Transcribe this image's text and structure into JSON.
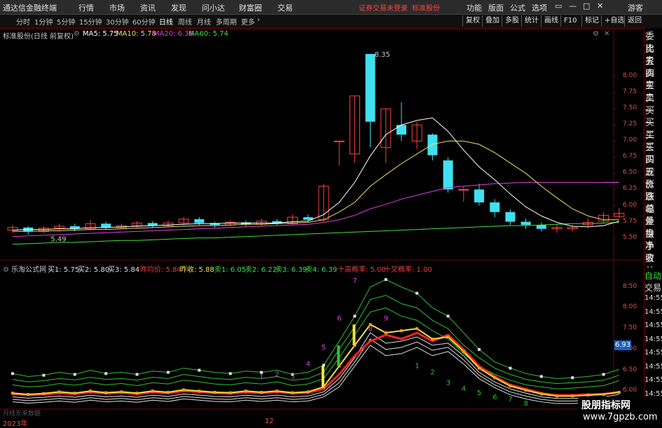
{
  "app": {
    "title": "通达信金融终端",
    "login_status": "证券交易未登录",
    "stock_name_top": "标准股份"
  },
  "top_menu": [
    "行情",
    "市场",
    "资讯",
    "发现",
    "问小达",
    "财富圈",
    "交易"
  ],
  "top_right_menu": [
    "功能",
    "版面",
    "公式",
    "选项"
  ],
  "user": "游客",
  "periods": [
    "分时",
    "1分钟",
    "5分钟",
    "15分钟",
    "30分钟",
    "60分钟",
    "日线",
    "周线",
    "月线",
    "多周期",
    "更多"
  ],
  "active_period": "日线",
  "toolbar": [
    "复权",
    "叠加",
    "多股",
    "统计",
    "画线",
    "F10",
    "标记",
    "+自选",
    "返回"
  ],
  "main_panel": {
    "title": "标准股份(日线 前复权)",
    "ma": [
      {
        "label": "MA5: 5.75",
        "color": "#ffffff"
      },
      {
        "label": "MA10: 5.78",
        "color": "#f0e060"
      },
      {
        "label": "MA20: 6.36",
        "color": "#e040e0"
      },
      {
        "label": "MA60: 5.74",
        "color": "#40e040"
      }
    ],
    "high_label": "8.35",
    "low_label": "5.49",
    "y_ticks": [
      "8.00",
      "7.75",
      "7.50",
      "7.25",
      "7.00",
      "6.75",
      "6.50",
      "6.25",
      "6.00",
      "5.75",
      "5.50"
    ]
  },
  "sub_panel": {
    "title": "乐淘公式网",
    "labels": [
      {
        "text": "买1: 5.75",
        "color": "#e0e0e0"
      },
      {
        "text": "买2: 5.80",
        "color": "#e0e0e0"
      },
      {
        "text": "买3: 5.84",
        "color": "#e0e0e0"
      },
      {
        "text": "昨均价: 5.84",
        "color": "#e04040"
      },
      {
        "text": "昨收: 5.88",
        "color": "#f0e060"
      },
      {
        "text": "卖1: 6.05",
        "color": "#40e040"
      },
      {
        "text": "卖2: 6.22",
        "color": "#40e040"
      },
      {
        "text": "卖3: 6.39",
        "color": "#40e040"
      },
      {
        "text": "卖4: 6.39",
        "color": "#40e040"
      },
      {
        "text": "十高概率: 5.00",
        "color": "#e04040"
      },
      {
        "text": "十叉概率: 1.00",
        "color": "#e04040"
      }
    ],
    "y_ticks": [
      "8.50",
      "8.00",
      "7.50",
      "7.00",
      "6.50",
      "6.00"
    ],
    "current_price": "6.93",
    "wave_numbers": [
      "1",
      "2",
      "3",
      "4",
      "5",
      "6",
      "7",
      "8",
      "9",
      "1",
      "2",
      "3",
      "4",
      "5",
      "6",
      "7",
      "8"
    ]
  },
  "side_labels": [
    "委比",
    "卖五",
    "卖四",
    "卖三",
    "卖二",
    "卖一",
    "买一",
    "买二",
    "买三",
    "买四",
    "买五",
    "现价",
    "涨跌",
    "涨幅",
    "总量",
    "外盘",
    "换手",
    "净资",
    "收益"
  ],
  "trade_panel": {
    "auto": "自动",
    "trade": "交易",
    "times": [
      "14:55",
      "14:55",
      "14:55",
      "14:55",
      "14:55",
      "14:55",
      "14:55",
      "14:55",
      "14:55"
    ]
  },
  "x_axis": [
    "2023年",
    "12"
  ],
  "watermark": {
    "line1": "股朋指标网",
    "line2": "www.7gpzb.com",
    "small": "月线东来数据"
  },
  "chart_data": {
    "type": "candlestick",
    "ylim": [
      5.3,
      8.6
    ],
    "candles": [
      {
        "o": 5.62,
        "c": 5.66,
        "h": 5.7,
        "l": 5.58
      },
      {
        "o": 5.66,
        "c": 5.6,
        "h": 5.68,
        "l": 5.55
      },
      {
        "o": 5.6,
        "c": 5.65,
        "h": 5.68,
        "l": 5.57
      },
      {
        "o": 5.65,
        "c": 5.68,
        "h": 5.72,
        "l": 5.62
      },
      {
        "o": 5.68,
        "c": 5.64,
        "h": 5.72,
        "l": 5.6
      },
      {
        "o": 5.64,
        "c": 5.72,
        "h": 5.78,
        "l": 5.62
      },
      {
        "o": 5.72,
        "c": 5.66,
        "h": 5.75,
        "l": 5.63
      },
      {
        "o": 5.66,
        "c": 5.69,
        "h": 5.72,
        "l": 5.64
      },
      {
        "o": 5.69,
        "c": 5.73,
        "h": 5.76,
        "l": 5.66
      },
      {
        "o": 5.73,
        "c": 5.69,
        "h": 5.76,
        "l": 5.66
      },
      {
        "o": 5.69,
        "c": 5.73,
        "h": 5.77,
        "l": 5.67
      },
      {
        "o": 5.73,
        "c": 5.79,
        "h": 5.82,
        "l": 5.7
      },
      {
        "o": 5.79,
        "c": 5.73,
        "h": 5.82,
        "l": 5.7
      },
      {
        "o": 5.73,
        "c": 5.7,
        "h": 5.75,
        "l": 5.66
      },
      {
        "o": 5.7,
        "c": 5.74,
        "h": 5.78,
        "l": 5.68
      },
      {
        "o": 5.74,
        "c": 5.71,
        "h": 5.77,
        "l": 5.68
      },
      {
        "o": 5.71,
        "c": 5.76,
        "h": 5.8,
        "l": 5.69
      },
      {
        "o": 5.76,
        "c": 5.72,
        "h": 5.79,
        "l": 5.7
      },
      {
        "o": 5.72,
        "c": 5.82,
        "h": 5.86,
        "l": 5.7
      },
      {
        "o": 5.82,
        "c": 5.78,
        "h": 5.86,
        "l": 5.75
      },
      {
        "o": 5.78,
        "c": 6.3,
        "h": 6.34,
        "l": 5.75
      },
      {
        "o": 7.0,
        "c": 7.0,
        "h": 7.0,
        "l": 6.62
      },
      {
        "o": 6.8,
        "c": 7.7,
        "h": 7.7,
        "l": 6.66
      },
      {
        "o": 8.35,
        "c": 7.3,
        "h": 8.35,
        "l": 6.9
      },
      {
        "o": 6.9,
        "c": 7.5,
        "h": 7.5,
        "l": 6.66
      },
      {
        "o": 7.25,
        "c": 7.1,
        "h": 7.6,
        "l": 7.0
      },
      {
        "o": 7.0,
        "c": 7.25,
        "h": 7.3,
        "l": 6.88
      },
      {
        "o": 7.1,
        "c": 6.78,
        "h": 7.12,
        "l": 6.7
      },
      {
        "o": 6.7,
        "c": 6.25,
        "h": 6.75,
        "l": 6.2
      },
      {
        "o": 6.25,
        "c": 6.25,
        "h": 6.3,
        "l": 6.06
      },
      {
        "o": 6.25,
        "c": 6.05,
        "h": 6.34,
        "l": 6.0
      },
      {
        "o": 6.05,
        "c": 5.9,
        "h": 6.1,
        "l": 5.82
      },
      {
        "o": 5.9,
        "c": 5.75,
        "h": 5.94,
        "l": 5.7
      },
      {
        "o": 5.75,
        "c": 5.7,
        "h": 5.8,
        "l": 5.64
      },
      {
        "o": 5.7,
        "c": 5.64,
        "h": 5.74,
        "l": 5.6
      },
      {
        "o": 5.64,
        "c": 5.66,
        "h": 5.7,
        "l": 5.58
      },
      {
        "o": 5.64,
        "c": 5.66,
        "h": 5.7,
        "l": 5.6
      },
      {
        "o": 5.7,
        "c": 5.74,
        "h": 5.8,
        "l": 5.66
      },
      {
        "o": 5.76,
        "c": 5.85,
        "h": 5.9,
        "l": 5.72
      },
      {
        "o": 5.83,
        "c": 5.88,
        "h": 5.96,
        "l": 5.8
      }
    ],
    "ma5": [
      5.62,
      5.63,
      5.63,
      5.64,
      5.64,
      5.66,
      5.66,
      5.67,
      5.68,
      5.69,
      5.7,
      5.71,
      5.72,
      5.72,
      5.73,
      5.73,
      5.73,
      5.73,
      5.75,
      5.76,
      5.86,
      6.05,
      6.36,
      6.77,
      7.1,
      7.25,
      7.32,
      7.36,
      7.15,
      6.86,
      6.6,
      6.4,
      6.18,
      5.98,
      5.84,
      5.74,
      5.68,
      5.67,
      5.69,
      5.76
    ],
    "ma10": [
      5.6,
      5.6,
      5.61,
      5.61,
      5.62,
      5.63,
      5.63,
      5.64,
      5.65,
      5.66,
      5.67,
      5.68,
      5.69,
      5.69,
      5.7,
      5.71,
      5.71,
      5.72,
      5.73,
      5.74,
      5.78,
      5.9,
      6.05,
      6.3,
      6.48,
      6.65,
      6.8,
      6.95,
      7.0,
      7.0,
      6.95,
      6.82,
      6.66,
      6.5,
      6.3,
      6.12,
      5.95,
      5.84,
      5.78,
      5.78
    ],
    "ma20": [
      5.52,
      5.53,
      5.54,
      5.55,
      5.56,
      5.57,
      5.58,
      5.59,
      5.6,
      5.61,
      5.62,
      5.63,
      5.64,
      5.65,
      5.66,
      5.67,
      5.68,
      5.69,
      5.7,
      5.71,
      5.74,
      5.78,
      5.85,
      5.95,
      6.02,
      6.1,
      6.16,
      6.22,
      6.28,
      6.3,
      6.32,
      6.34,
      6.35,
      6.36,
      6.36,
      6.36,
      6.36,
      6.36,
      6.36,
      6.36
    ],
    "ma60": [
      5.4,
      5.41,
      5.42,
      5.43,
      5.43,
      5.44,
      5.45,
      5.46,
      5.46,
      5.47,
      5.48,
      5.49,
      5.5,
      5.5,
      5.51,
      5.52,
      5.53,
      5.54,
      5.55,
      5.56,
      5.57,
      5.58,
      5.59,
      5.6,
      5.61,
      5.62,
      5.63,
      5.64,
      5.65,
      5.66,
      5.67,
      5.68,
      5.69,
      5.69,
      5.7,
      5.71,
      5.72,
      5.72,
      5.73,
      5.74
    ],
    "sub": {
      "ylim": [
        5.6,
        8.9
      ],
      "green_lines": [
        [
          6.42,
          6.35,
          6.38,
          6.45,
          6.4,
          6.5,
          6.42,
          6.45,
          6.4,
          6.48,
          6.45,
          6.55,
          6.5,
          6.45,
          6.42,
          6.48,
          6.45,
          6.5,
          6.4,
          6.45,
          6.62,
          7.2,
          7.8,
          8.5,
          8.68,
          8.5,
          8.35,
          8.0,
          7.8,
          7.4,
          7.0,
          6.7,
          6.55,
          6.42,
          6.35,
          6.3,
          6.32,
          6.35,
          6.4,
          6.52
        ],
        [
          6.28,
          6.22,
          6.25,
          6.3,
          6.27,
          6.33,
          6.28,
          6.3,
          6.26,
          6.33,
          6.3,
          6.4,
          6.35,
          6.3,
          6.28,
          6.33,
          6.3,
          6.35,
          6.26,
          6.3,
          6.45,
          7.0,
          7.55,
          8.2,
          8.3,
          8.1,
          8.0,
          7.7,
          7.5,
          7.1,
          6.8,
          6.55,
          6.4,
          6.28,
          6.22,
          6.18,
          6.2,
          6.22,
          6.26,
          6.38
        ],
        [
          6.15,
          6.1,
          6.12,
          6.18,
          6.14,
          6.2,
          6.15,
          6.18,
          6.13,
          6.2,
          6.17,
          6.26,
          6.22,
          6.17,
          6.15,
          6.2,
          6.17,
          6.22,
          6.13,
          6.17,
          6.3,
          6.8,
          7.35,
          7.9,
          8.0,
          7.8,
          7.7,
          7.45,
          7.25,
          6.9,
          6.6,
          6.4,
          6.26,
          6.15,
          6.1,
          6.05,
          6.07,
          6.1,
          6.13,
          6.25
        ]
      ],
      "red_line": [
        5.93,
        5.9,
        5.92,
        5.95,
        5.93,
        5.97,
        5.94,
        5.96,
        5.93,
        5.97,
        5.95,
        6.0,
        5.98,
        5.95,
        5.94,
        5.97,
        5.95,
        5.98,
        5.94,
        5.96,
        6.05,
        6.4,
        6.85,
        7.2,
        7.35,
        7.25,
        7.4,
        7.2,
        7.35,
        7.0,
        6.6,
        6.35,
        6.15,
        6.05,
        5.95,
        5.9,
        5.9,
        5.92,
        5.93,
        5.98
      ],
      "yellow_line": [
        5.95,
        5.92,
        5.94,
        5.98,
        5.95,
        6.0,
        5.96,
        5.98,
        5.95,
        6.0,
        5.97,
        6.03,
        6.0,
        5.97,
        5.96,
        6.0,
        5.97,
        6.0,
        5.96,
        5.98,
        6.1,
        6.6,
        7.1,
        7.6,
        7.4,
        7.45,
        7.5,
        7.25,
        7.3,
        6.95,
        6.55,
        6.32,
        6.12,
        6.02,
        5.93,
        5.88,
        5.88,
        5.9,
        5.92,
        5.97
      ],
      "white_lines": [
        [
          5.86,
          5.83,
          5.85,
          5.88,
          5.85,
          5.9,
          5.86,
          5.88,
          5.85,
          5.9,
          5.87,
          5.93,
          5.9,
          5.87,
          5.86,
          5.9,
          5.87,
          5.9,
          5.86,
          5.88,
          5.98,
          6.3,
          6.8,
          7.4,
          7.15,
          7.2,
          7.3,
          7.1,
          7.15,
          6.85,
          6.45,
          6.22,
          6.05,
          5.95,
          5.86,
          5.82,
          5.82,
          5.84,
          5.86,
          5.92
        ],
        [
          5.8,
          5.77,
          5.79,
          5.82,
          5.79,
          5.84,
          5.8,
          5.82,
          5.79,
          5.84,
          5.81,
          5.87,
          5.84,
          5.81,
          5.8,
          5.84,
          5.81,
          5.84,
          5.8,
          5.82,
          5.92,
          6.2,
          6.7,
          7.25,
          7.0,
          7.05,
          7.18,
          6.98,
          7.05,
          6.75,
          6.38,
          6.15,
          5.98,
          5.88,
          5.8,
          5.76,
          5.76,
          5.78,
          5.8,
          5.86
        ],
        [
          5.74,
          5.71,
          5.73,
          5.76,
          5.73,
          5.78,
          5.74,
          5.76,
          5.73,
          5.78,
          5.75,
          5.81,
          5.78,
          5.75,
          5.74,
          5.78,
          5.75,
          5.78,
          5.74,
          5.76,
          5.86,
          6.1,
          6.6,
          7.1,
          6.85,
          6.9,
          7.05,
          6.85,
          6.95,
          6.65,
          6.3,
          6.08,
          5.91,
          5.81,
          5.74,
          5.7,
          5.7,
          5.72,
          5.74,
          5.8
        ]
      ]
    }
  }
}
